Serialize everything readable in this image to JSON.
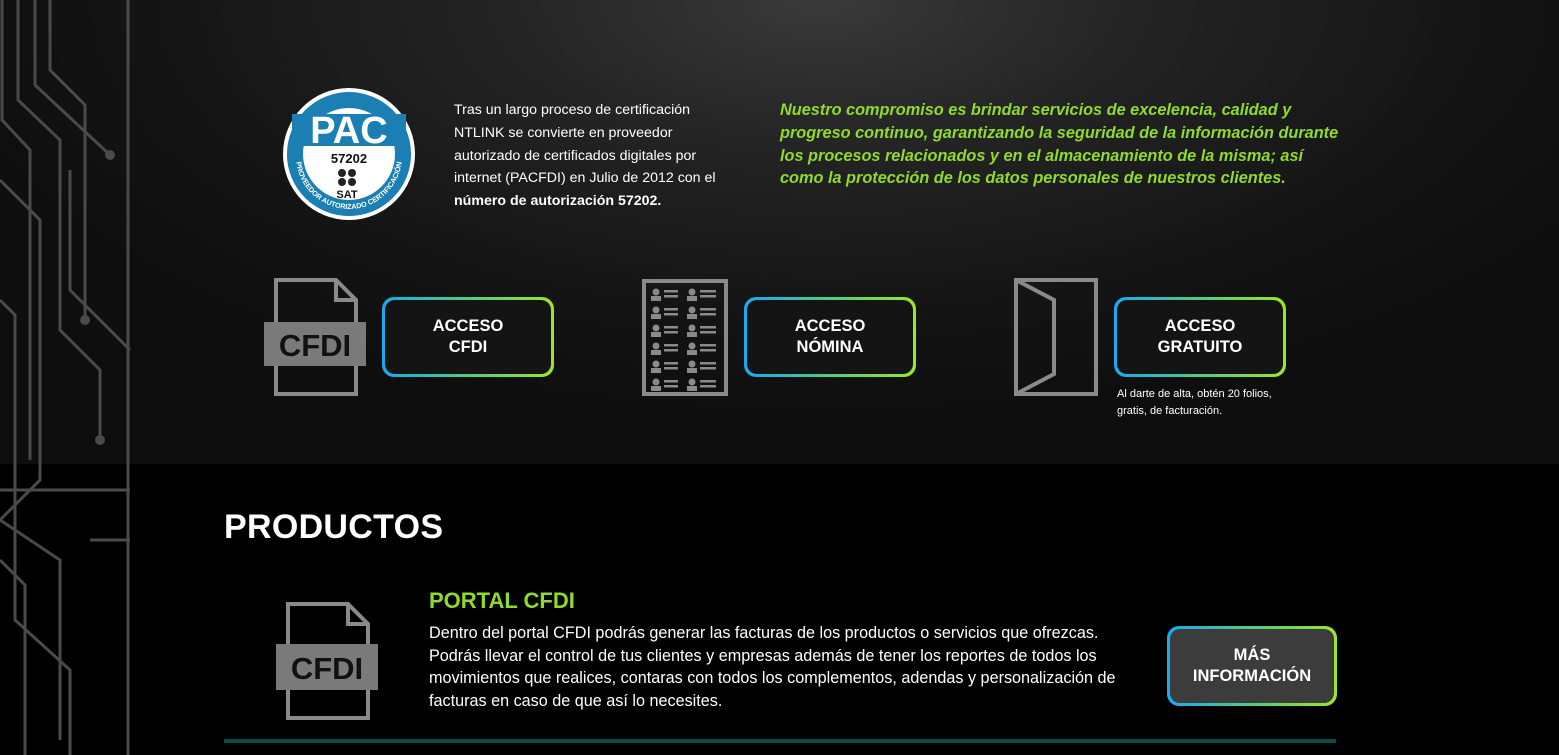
{
  "seal": {
    "pac": "PAC",
    "number": "57202",
    "sat": "SAT",
    "ring_text": "PROVEEDOR AUTORIZADO CERTIFICACIÓN"
  },
  "certification": {
    "text": "Tras un largo proceso de certificación NTLINK se convierte en proveedor autorizado de certificados digitales por internet (PACFDI) en Julio de 2012 con el",
    "bold": "número de autorización 57202."
  },
  "commitment": "Nuestro compromiso es brindar servicios de excelencia, calidad y progreso continuo, garantizando la seguridad de la información durante los procesos relacionados y en el almacenamiento de la misma; así como la protección de los datos personales de nuestros clientes.",
  "access": {
    "cfdi_icon_label": "CFDI",
    "cfdi": "ACCESO\nCFDI",
    "nomina": "ACCESO\nNÓMINA",
    "gratuito": "ACCESO\nGRATUITO",
    "gratuito_note": "Al darte de alta, obtén 20 folios, gratis, de facturación."
  },
  "products": {
    "title": "PRODUCTOS",
    "items": [
      {
        "icon_label": "CFDI",
        "title": "PORTAL CFDI",
        "description": "Dentro del portal CFDI podrás generar las facturas de los productos o servicios que ofrezcas. Podrás llevar el control de tus clientes y empresas además de tener los reportes de todos los movimientos que realices, contaras con todos los complementos, adendas y personalización de facturas en caso de que así lo necesites.",
        "button": "MÁS\nINFORMACIÓN"
      }
    ]
  },
  "colors": {
    "accent_green": "#8edb2b",
    "gradient_blue": "#1aa8f0",
    "divider_teal": "#0d4a45"
  }
}
